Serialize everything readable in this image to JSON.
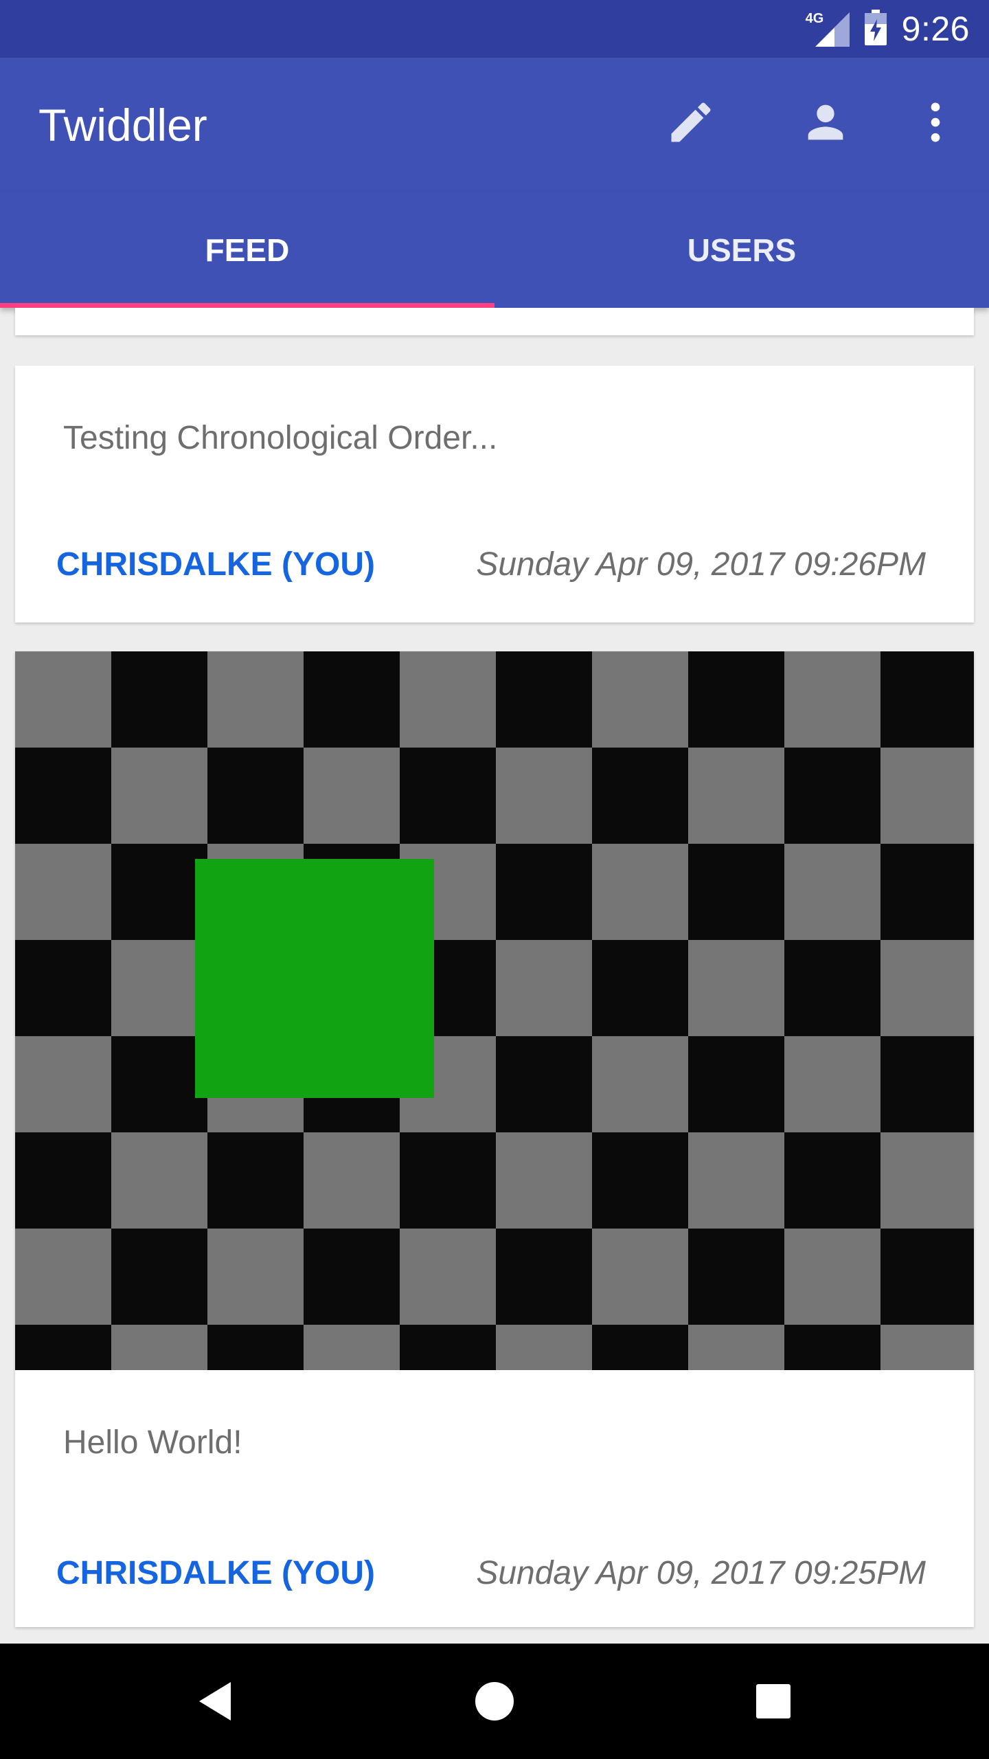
{
  "status_bar": {
    "network_label": "4G",
    "time": "9:26",
    "icons": [
      "signal-icon",
      "battery-icon"
    ]
  },
  "app_bar": {
    "title": "Twiddler",
    "actions": [
      "edit-icon",
      "profile-icon",
      "overflow-menu-icon"
    ]
  },
  "tabs": [
    {
      "label": "FEED",
      "selected": true
    },
    {
      "label": "USERS",
      "selected": false
    }
  ],
  "colors": {
    "primary": "#3f51b5",
    "primary_dark": "#303f9f",
    "accent": "#ff4081",
    "username": "#1565e0"
  },
  "feed": {
    "posts": [
      {
        "text": "Testing Chronological Order...",
        "author": "CHRISDALKE (YOU)",
        "timestamp": "Sunday Apr 09, 2017 09:26PM",
        "has_image": false
      },
      {
        "text": "Hello World!",
        "author": "CHRISDALKE (YOU)",
        "timestamp": "Sunday Apr 09, 2017 09:25PM",
        "has_image": true,
        "image_description": "checkerboard-with-green-square"
      }
    ]
  },
  "nav_bar": {
    "buttons": [
      "back-icon",
      "home-icon",
      "recents-icon"
    ]
  }
}
